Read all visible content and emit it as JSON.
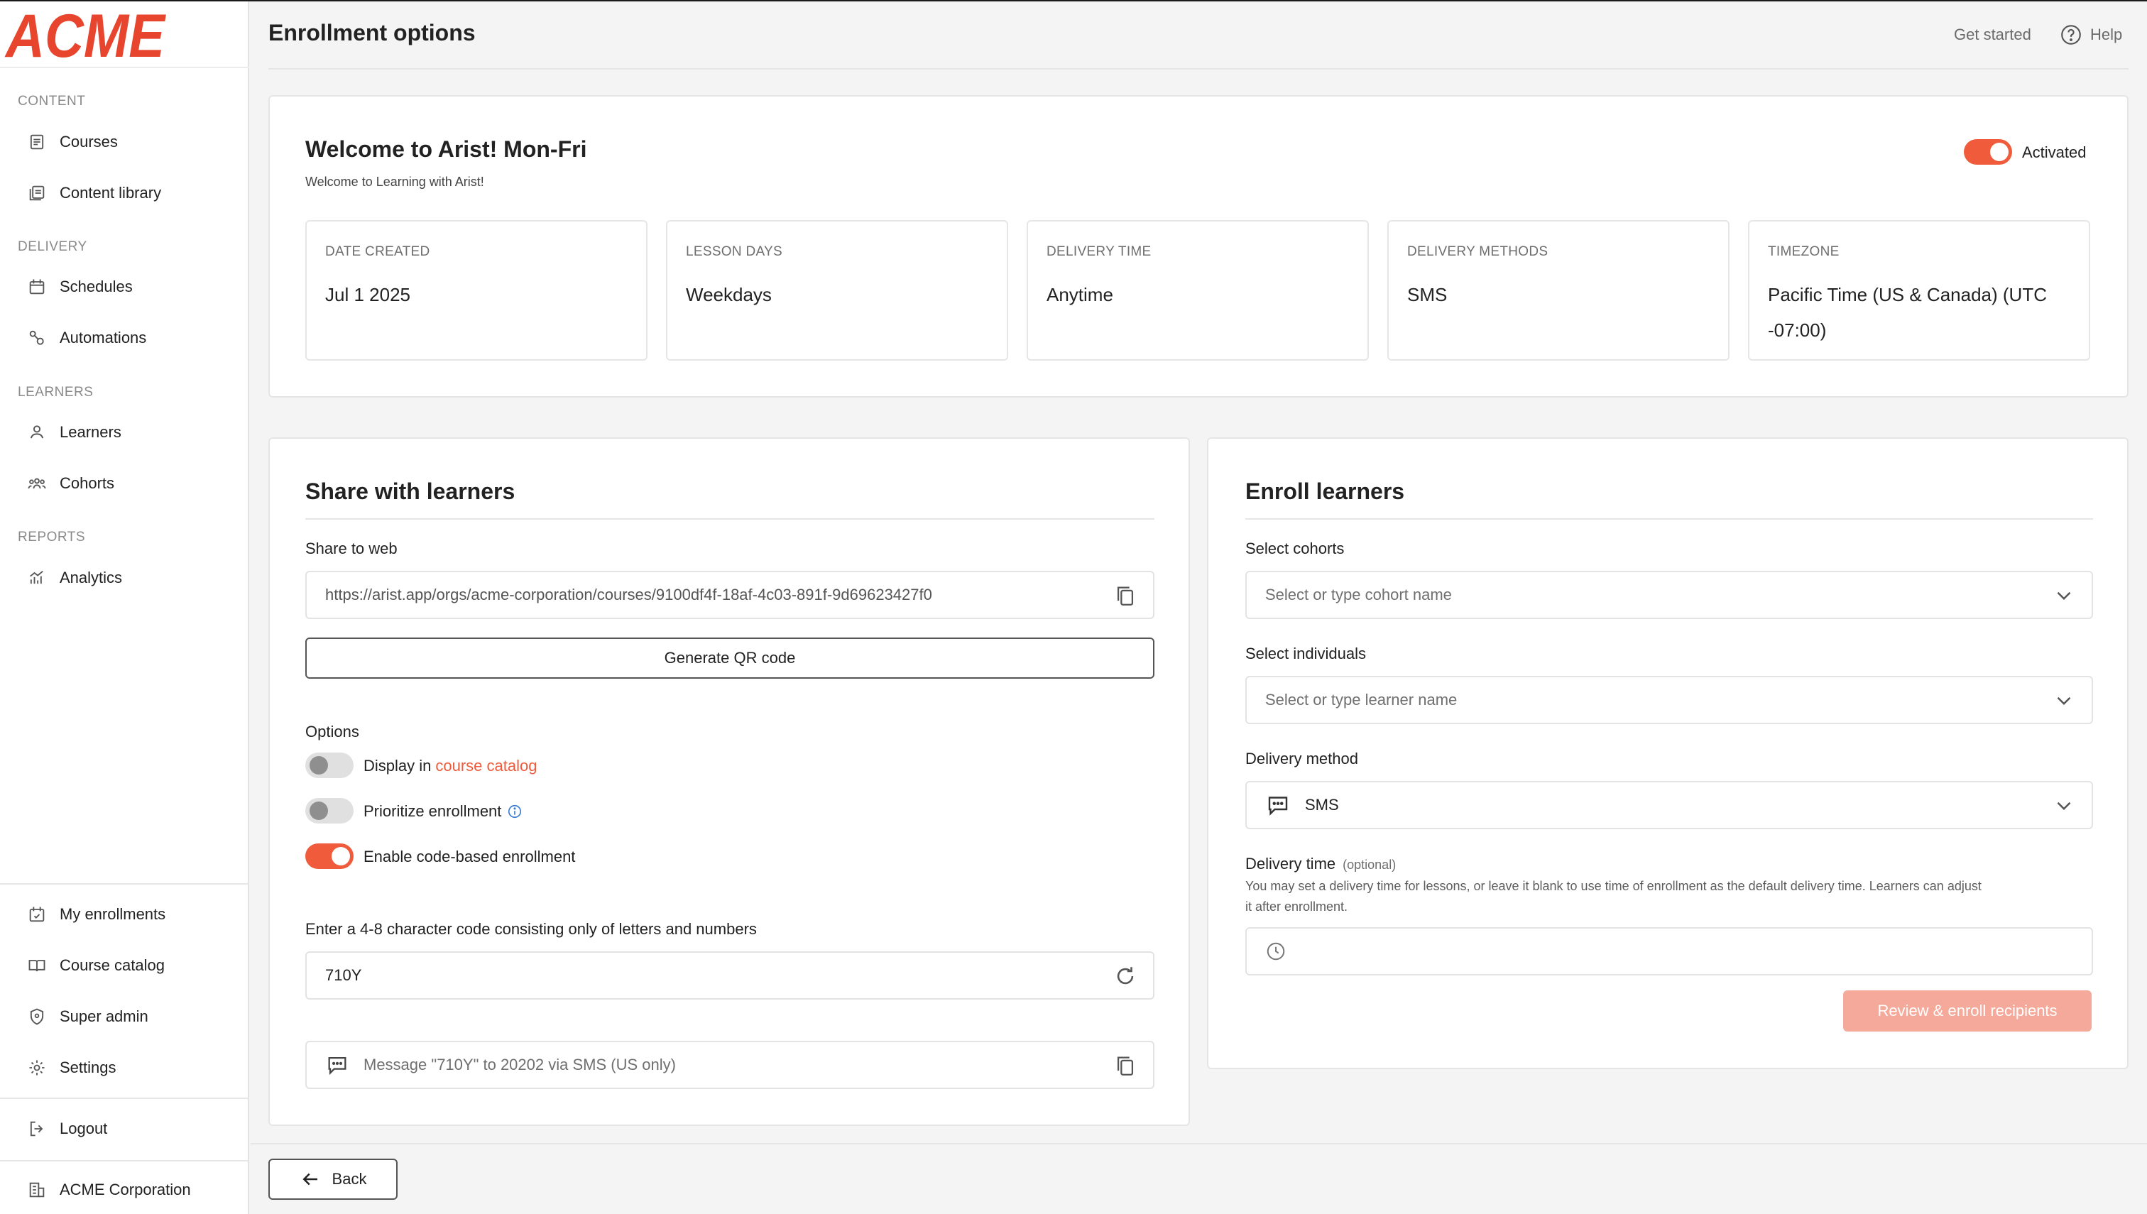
{
  "brand": {
    "logo_text": "ACME",
    "accent": "#ef5b3b"
  },
  "sidebar": {
    "sections": {
      "content": "CONTENT",
      "delivery": "DELIVERY",
      "learners": "LEARNERS",
      "reports": "REPORTS"
    },
    "items": {
      "courses": "Courses",
      "content_library": "Content library",
      "schedules": "Schedules",
      "automations": "Automations",
      "learners": "Learners",
      "cohorts": "Cohorts",
      "analytics": "Analytics",
      "my_enrollments": "My enrollments",
      "course_catalog": "Course catalog",
      "super_admin": "Super admin",
      "settings": "Settings",
      "logout": "Logout",
      "organization": "ACME Corporation"
    }
  },
  "header": {
    "title": "Enrollment options",
    "get_started": "Get started",
    "help": "Help"
  },
  "summary": {
    "title": "Welcome to Arist! Mon-Fri",
    "subtitle": "Welcome to Learning with Arist!",
    "status_label": "Activated",
    "status_on": true,
    "boxes": [
      {
        "label": "DATE CREATED",
        "value": "Jul 1 2025"
      },
      {
        "label": "LESSON DAYS",
        "value": "Weekdays"
      },
      {
        "label": "DELIVERY TIME",
        "value": "Anytime"
      },
      {
        "label": "DELIVERY METHODS",
        "value": "SMS"
      },
      {
        "label": "TIMEZONE",
        "value": "Pacific Time (US & Canada) (UTC -07:00)"
      }
    ]
  },
  "share": {
    "title": "Share with learners",
    "share_to_web_label": "Share to web",
    "url": "https://arist.app/orgs/acme-corporation/courses/9100df4f-18af-4c03-891f-9d69623427f0",
    "qr_button": "Generate QR code",
    "options_label": "Options",
    "options": {
      "display_prefix": "Display in",
      "display_link": "course catalog",
      "prioritize": "Prioritize enrollment",
      "code_based": "Enable code-based enrollment"
    },
    "code_label": "Enter a 4-8 character code consisting only of letters and numbers",
    "code_value": "710Y",
    "sms_message": "Message \"710Y\" to 20202 via SMS (US only)"
  },
  "enroll": {
    "title": "Enroll learners",
    "cohorts_label": "Select cohorts",
    "cohorts_placeholder": "Select or type cohort name",
    "individuals_label": "Select individuals",
    "individuals_placeholder": "Select or type learner name",
    "method_label": "Delivery method",
    "method_value": "SMS",
    "time_label": "Delivery time",
    "time_optional": "(optional)",
    "time_help_1": "You may set a delivery time for lessons, or leave it blank to use time of enrollment as the default delivery time. Learners can adjust",
    "time_help_2": "it after enrollment.",
    "review_button": "Review & enroll recipients"
  },
  "footer": {
    "back": "Back"
  }
}
